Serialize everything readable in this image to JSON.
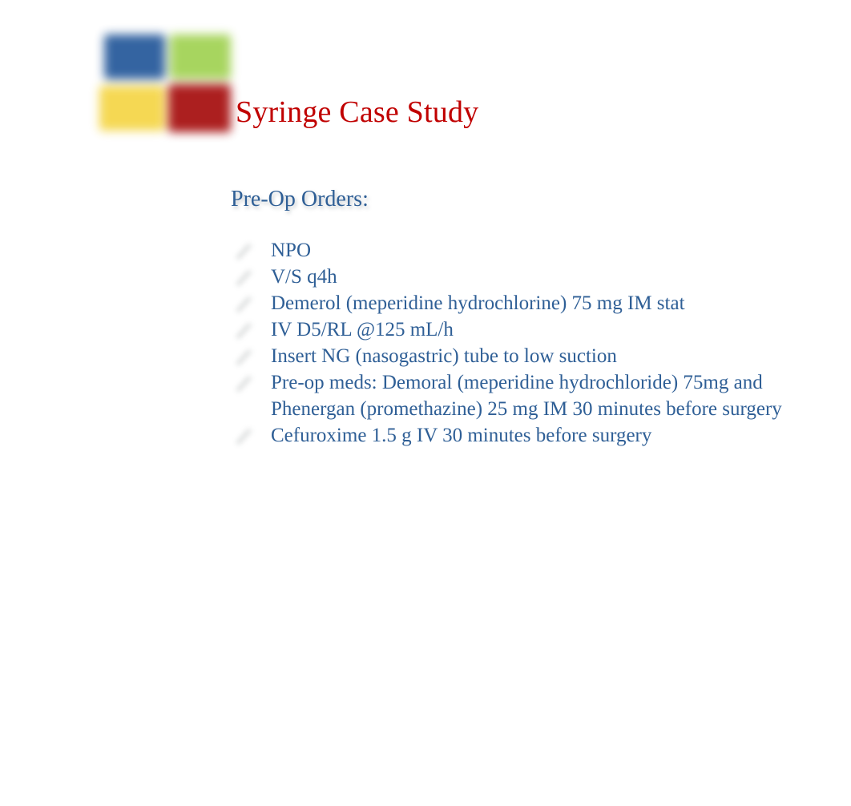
{
  "slide": {
    "background_color": "#ffffff",
    "title": "Syringe Case Study",
    "title_color": "#c00000",
    "body_text_color": "#2f5f96"
  },
  "logo": {
    "name": "four-square-logo",
    "cells": [
      {
        "name": "logo-cell-blue",
        "color": "#2e5f9e"
      },
      {
        "name": "logo-cell-green",
        "color": "#a5d45a"
      },
      {
        "name": "logo-cell-yellow",
        "color": "#f5d74e"
      },
      {
        "name": "logo-cell-red",
        "color": "#aa1818"
      }
    ]
  },
  "content": {
    "heading": "Pre-Op Orders:",
    "bullet_icon": "pencil-bullet-icon",
    "items": [
      "NPO",
      "V/S q4h",
      "Demerol (meperidine hydrochlorine) 75 mg IM stat",
      "IV D5/RL @125 mL/h",
      "Insert NG (nasogastric) tube to low suction",
      "Pre-op meds: Demoral (meperidine hydrochloride) 75mg and Phenergan (promethazine) 25 mg IM 30 minutes before surgery",
      "Cefuroxime 1.5 g IV 30 minutes before surgery"
    ]
  }
}
